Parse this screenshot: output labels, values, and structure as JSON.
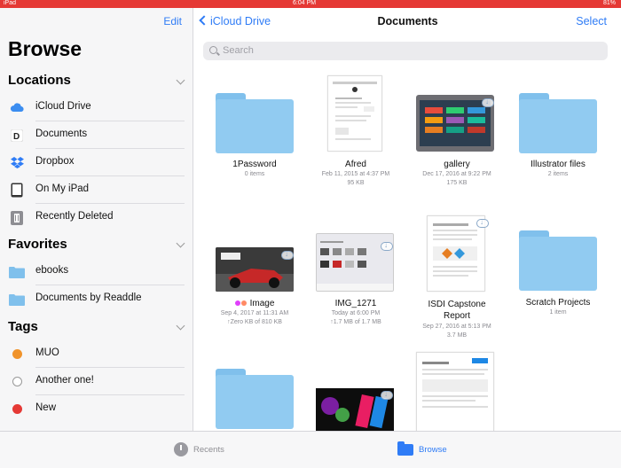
{
  "status": {
    "left": "iPad",
    "time": "6:04 PM",
    "battery": "81%"
  },
  "sidebar": {
    "edit_label": "Edit",
    "title": "Browse",
    "locations_header": "Locations",
    "locations": [
      {
        "label": "iCloud Drive",
        "icon": "cloud-icon"
      },
      {
        "label": "Documents",
        "icon": "documents-app-icon"
      },
      {
        "label": "Dropbox",
        "icon": "dropbox-icon"
      },
      {
        "label": "On My iPad",
        "icon": "ipad-icon"
      },
      {
        "label": "Recently Deleted",
        "icon": "trash-icon"
      }
    ],
    "favorites_header": "Favorites",
    "favorites": [
      {
        "label": "ebooks",
        "icon": "folder-icon"
      },
      {
        "label": "Documents by Readdle",
        "icon": "folder-icon"
      }
    ],
    "tags_header": "Tags",
    "tags": [
      {
        "label": "MUO",
        "color": "#f0932b"
      },
      {
        "label": "Another one!",
        "color": "#ffffff"
      },
      {
        "label": "New",
        "color": "#e53935"
      }
    ]
  },
  "nav": {
    "back_label": "iCloud Drive",
    "title": "Documents",
    "select_label": "Select"
  },
  "search": {
    "placeholder": "Search"
  },
  "items": [
    {
      "name": "1Password",
      "meta1": "0 items",
      "meta2": "",
      "kind": "folder"
    },
    {
      "name": "Afred",
      "meta1": "Feb 11, 2015 at 4:37 PM",
      "meta2": "95 KB",
      "kind": "document"
    },
    {
      "name": "gallery",
      "meta1": "Dec 17, 2016 at 9:22 PM",
      "meta2": "175 KB",
      "kind": "screenshot"
    },
    {
      "name": "Illustrator files",
      "meta1": "2 items",
      "meta2": "",
      "kind": "folder"
    },
    {
      "name": "Image",
      "meta1": "Sep 4, 2017 at 11:31 AM",
      "meta2": "↑Zero KB of 810 KB",
      "kind": "photo"
    },
    {
      "name": "IMG_1271",
      "meta1": "Today at 6:00 PM",
      "meta2": "↑1.7 MB of 1.7 MB",
      "kind": "screenshot"
    },
    {
      "name": "ISDI Capstone Report",
      "meta1": "Sep 27, 2016 at 5:13 PM",
      "meta2": "3.7 MB",
      "kind": "document"
    },
    {
      "name": "Scratch Projects",
      "meta1": "1 item",
      "meta2": "",
      "kind": "folder"
    }
  ],
  "tabbar": {
    "recents_label": "Recents",
    "browse_label": "Browse"
  },
  "colors": {
    "accent": "#2f7cf6",
    "folder": "#91cbf1",
    "status_bar": "#e53935"
  }
}
